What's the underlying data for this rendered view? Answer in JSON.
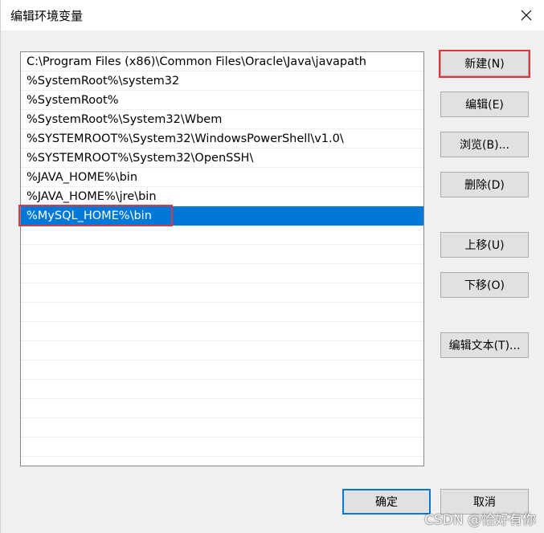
{
  "window": {
    "title": "编辑环境变量"
  },
  "paths": [
    "C:\\Program Files (x86)\\Common Files\\Oracle\\Java\\javapath",
    "%SystemRoot%\\system32",
    "%SystemRoot%",
    "%SystemRoot%\\System32\\Wbem",
    "%SYSTEMROOT%\\System32\\WindowsPowerShell\\v1.0\\",
    "%SYSTEMROOT%\\System32\\OpenSSH\\",
    "%JAVA_HOME%\\bin",
    "%JAVA_HOME%\\jre\\bin",
    "%MySQL_HOME%\\bin"
  ],
  "selected_index": 8,
  "buttons": {
    "new": "新建(N)",
    "edit": "编辑(E)",
    "browse": "浏览(B)...",
    "delete": "删除(D)",
    "move_up": "上移(U)",
    "move_down": "下移(O)",
    "edit_text": "编辑文本(T)...",
    "ok": "确定",
    "cancel": "取消"
  },
  "watermark": "CSDN @恰好有你",
  "colors": {
    "selection": "#0078d7",
    "highlight_box": "#e0373e"
  }
}
